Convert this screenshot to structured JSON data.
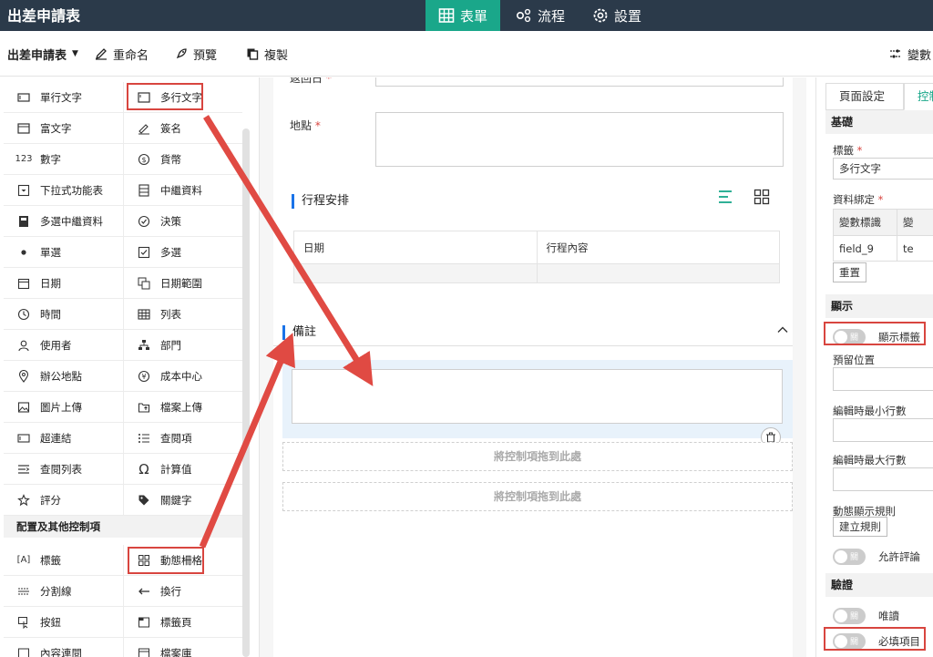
{
  "app": {
    "title": "出差申請表"
  },
  "top_tabs": [
    {
      "label": "表單",
      "icon": "table-icon"
    },
    {
      "label": "流程",
      "icon": "flow-icon"
    },
    {
      "label": "設置",
      "icon": "gear-icon"
    }
  ],
  "toolbar": {
    "form_name": "出差申請表",
    "rename": "重命名",
    "preview": "預覽",
    "copy": "複製",
    "variables": "變數"
  },
  "palette": {
    "items": [
      [
        "單行文字",
        "多行文字"
      ],
      [
        "富文字",
        "簽名"
      ],
      [
        "數字",
        "貨幣"
      ],
      [
        "下拉式功能表",
        "中繼資料"
      ],
      [
        "多選中繼資料",
        "決策"
      ],
      [
        "單選",
        "多選"
      ],
      [
        "日期",
        "日期範圍"
      ],
      [
        "時間",
        "列表"
      ],
      [
        "使用者",
        "部門"
      ],
      [
        "辦公地點",
        "成本中心"
      ],
      [
        "圖片上傳",
        "檔案上傳"
      ],
      [
        "超連結",
        "查閱項"
      ],
      [
        "查閱列表",
        "計算值"
      ],
      [
        "評分",
        "關鍵字"
      ]
    ],
    "section2_title": "配置及其他控制項",
    "items2": [
      [
        "標籤",
        "動態柵格"
      ],
      [
        "分割線",
        "換行"
      ],
      [
        "按鈕",
        "標籤頁"
      ],
      [
        "內容連閱",
        "檔案庫"
      ]
    ],
    "number_icon": "123"
  },
  "canvas": {
    "return_date_label": "返回日",
    "location_label": "地點",
    "schedule_title": "行程安排",
    "schedule_columns": [
      "日期",
      "行程內容"
    ],
    "remarks_title": "備註",
    "drop_hint_1": "將控制項拖到此處",
    "drop_hint_2": "將控制項拖到此處"
  },
  "right_panel": {
    "tab_page": "頁面設定",
    "tab_control": "控制",
    "basic_header": "基礎",
    "label_title": "標籤",
    "label_value": "多行文字",
    "binding_title": "資料綁定",
    "binding_col1": "變數標識",
    "binding_col2": "變",
    "binding_val1": "field_9",
    "binding_val2": "te",
    "reset_button": "重置",
    "display_header": "顯示",
    "show_label": "顯示標籤",
    "placeholder_title": "預留位置",
    "min_rows_title": "編輯時最小行數",
    "max_rows_title": "編輯時最大行數",
    "dynamic_rules_title": "動態顯示規則",
    "create_rule_button": "建立規則",
    "allow_comments": "允許評論",
    "validation_header": "驗證",
    "readonly": "唯讀",
    "required": "必填項目",
    "toggle_off_text": "關"
  },
  "colors": {
    "topbar": "#2b3a4a",
    "accent": "#1aa78a",
    "highlight": "#d8453f",
    "section_bar": "#1a73e8"
  }
}
